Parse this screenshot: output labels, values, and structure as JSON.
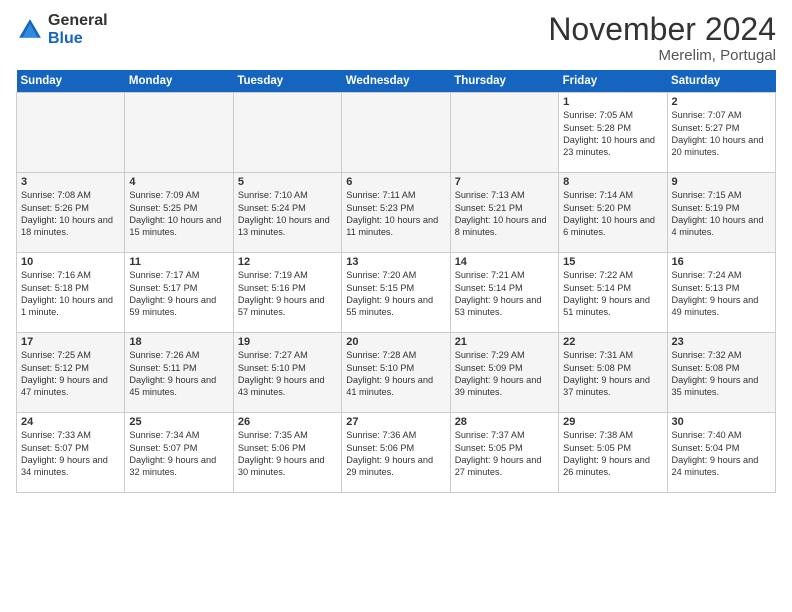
{
  "logo": {
    "line1": "General",
    "line2": "Blue"
  },
  "title": "November 2024",
  "location": "Merelim, Portugal",
  "days_header": [
    "Sunday",
    "Monday",
    "Tuesday",
    "Wednesday",
    "Thursday",
    "Friday",
    "Saturday"
  ],
  "weeks": [
    [
      {
        "day": "",
        "info": "",
        "empty": true
      },
      {
        "day": "",
        "info": "",
        "empty": true
      },
      {
        "day": "",
        "info": "",
        "empty": true
      },
      {
        "day": "",
        "info": "",
        "empty": true
      },
      {
        "day": "",
        "info": "",
        "empty": true
      },
      {
        "day": "1",
        "info": "Sunrise: 7:05 AM\nSunset: 5:28 PM\nDaylight: 10 hours and 23 minutes.",
        "empty": false
      },
      {
        "day": "2",
        "info": "Sunrise: 7:07 AM\nSunset: 5:27 PM\nDaylight: 10 hours and 20 minutes.",
        "empty": false
      }
    ],
    [
      {
        "day": "3",
        "info": "Sunrise: 7:08 AM\nSunset: 5:26 PM\nDaylight: 10 hours and 18 minutes.",
        "empty": false
      },
      {
        "day": "4",
        "info": "Sunrise: 7:09 AM\nSunset: 5:25 PM\nDaylight: 10 hours and 15 minutes.",
        "empty": false
      },
      {
        "day": "5",
        "info": "Sunrise: 7:10 AM\nSunset: 5:24 PM\nDaylight: 10 hours and 13 minutes.",
        "empty": false
      },
      {
        "day": "6",
        "info": "Sunrise: 7:11 AM\nSunset: 5:23 PM\nDaylight: 10 hours and 11 minutes.",
        "empty": false
      },
      {
        "day": "7",
        "info": "Sunrise: 7:13 AM\nSunset: 5:21 PM\nDaylight: 10 hours and 8 minutes.",
        "empty": false
      },
      {
        "day": "8",
        "info": "Sunrise: 7:14 AM\nSunset: 5:20 PM\nDaylight: 10 hours and 6 minutes.",
        "empty": false
      },
      {
        "day": "9",
        "info": "Sunrise: 7:15 AM\nSunset: 5:19 PM\nDaylight: 10 hours and 4 minutes.",
        "empty": false
      }
    ],
    [
      {
        "day": "10",
        "info": "Sunrise: 7:16 AM\nSunset: 5:18 PM\nDaylight: 10 hours and 1 minute.",
        "empty": false
      },
      {
        "day": "11",
        "info": "Sunrise: 7:17 AM\nSunset: 5:17 PM\nDaylight: 9 hours and 59 minutes.",
        "empty": false
      },
      {
        "day": "12",
        "info": "Sunrise: 7:19 AM\nSunset: 5:16 PM\nDaylight: 9 hours and 57 minutes.",
        "empty": false
      },
      {
        "day": "13",
        "info": "Sunrise: 7:20 AM\nSunset: 5:15 PM\nDaylight: 9 hours and 55 minutes.",
        "empty": false
      },
      {
        "day": "14",
        "info": "Sunrise: 7:21 AM\nSunset: 5:14 PM\nDaylight: 9 hours and 53 minutes.",
        "empty": false
      },
      {
        "day": "15",
        "info": "Sunrise: 7:22 AM\nSunset: 5:14 PM\nDaylight: 9 hours and 51 minutes.",
        "empty": false
      },
      {
        "day": "16",
        "info": "Sunrise: 7:24 AM\nSunset: 5:13 PM\nDaylight: 9 hours and 49 minutes.",
        "empty": false
      }
    ],
    [
      {
        "day": "17",
        "info": "Sunrise: 7:25 AM\nSunset: 5:12 PM\nDaylight: 9 hours and 47 minutes.",
        "empty": false
      },
      {
        "day": "18",
        "info": "Sunrise: 7:26 AM\nSunset: 5:11 PM\nDaylight: 9 hours and 45 minutes.",
        "empty": false
      },
      {
        "day": "19",
        "info": "Sunrise: 7:27 AM\nSunset: 5:10 PM\nDaylight: 9 hours and 43 minutes.",
        "empty": false
      },
      {
        "day": "20",
        "info": "Sunrise: 7:28 AM\nSunset: 5:10 PM\nDaylight: 9 hours and 41 minutes.",
        "empty": false
      },
      {
        "day": "21",
        "info": "Sunrise: 7:29 AM\nSunset: 5:09 PM\nDaylight: 9 hours and 39 minutes.",
        "empty": false
      },
      {
        "day": "22",
        "info": "Sunrise: 7:31 AM\nSunset: 5:08 PM\nDaylight: 9 hours and 37 minutes.",
        "empty": false
      },
      {
        "day": "23",
        "info": "Sunrise: 7:32 AM\nSunset: 5:08 PM\nDaylight: 9 hours and 35 minutes.",
        "empty": false
      }
    ],
    [
      {
        "day": "24",
        "info": "Sunrise: 7:33 AM\nSunset: 5:07 PM\nDaylight: 9 hours and 34 minutes.",
        "empty": false
      },
      {
        "day": "25",
        "info": "Sunrise: 7:34 AM\nSunset: 5:07 PM\nDaylight: 9 hours and 32 minutes.",
        "empty": false
      },
      {
        "day": "26",
        "info": "Sunrise: 7:35 AM\nSunset: 5:06 PM\nDaylight: 9 hours and 30 minutes.",
        "empty": false
      },
      {
        "day": "27",
        "info": "Sunrise: 7:36 AM\nSunset: 5:06 PM\nDaylight: 9 hours and 29 minutes.",
        "empty": false
      },
      {
        "day": "28",
        "info": "Sunrise: 7:37 AM\nSunset: 5:05 PM\nDaylight: 9 hours and 27 minutes.",
        "empty": false
      },
      {
        "day": "29",
        "info": "Sunrise: 7:38 AM\nSunset: 5:05 PM\nDaylight: 9 hours and 26 minutes.",
        "empty": false
      },
      {
        "day": "30",
        "info": "Sunrise: 7:40 AM\nSunset: 5:04 PM\nDaylight: 9 hours and 24 minutes.",
        "empty": false
      }
    ]
  ]
}
